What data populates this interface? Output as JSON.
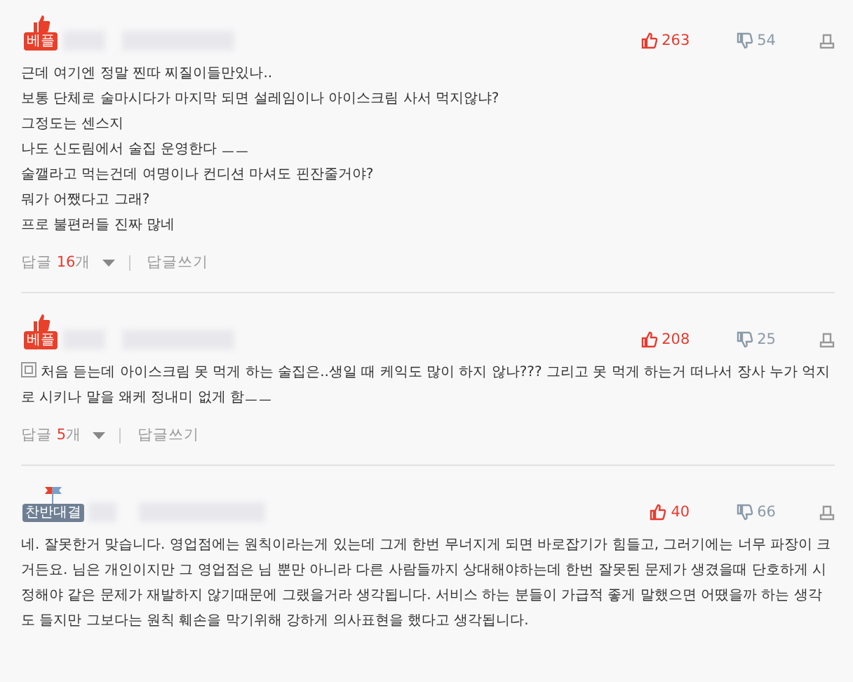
{
  "comments": [
    {
      "badge": {
        "kind": "best",
        "label": "베플"
      },
      "likes": "263",
      "dislikes": "54",
      "memo_icon": false,
      "lines": [
        "근데 여기엔 정말 찐따 찌질이들만있나..",
        "보통 단체로 술마시다가 마지막 되면 설레임이나 아이스크림 사서 먹지않냐?",
        "그정도는 센스지",
        "나도 신도림에서 술집 운영한다 ㅡㅡ",
        "술깰라고 먹는건데 여명이나 컨디션 마셔도 핀잔줄거야?",
        "뭐가 어쨌다고 그래?",
        "프로 불편러들 진짜 많네"
      ],
      "replies": {
        "label": "답글",
        "count": "16",
        "unit": "개",
        "write": "답글쓰기"
      }
    },
    {
      "badge": {
        "kind": "best",
        "label": "베플"
      },
      "likes": "208",
      "dislikes": "25",
      "memo_icon": true,
      "lines": [
        "처음 듣는데 아이스크림 못 먹게 하는 술집은..생일 때 케익도 많이 하지 않나??? 그리고 못 먹게 하는거 떠나서 장사 누가 억지로 시키나 말을 왜케 정내미 없게 함ㅡㅡ"
      ],
      "replies": {
        "label": "답글",
        "count": "5",
        "unit": "개",
        "write": "답글쓰기"
      }
    },
    {
      "badge": {
        "kind": "debate",
        "label": "찬반대결"
      },
      "likes": "40",
      "dislikes": "66",
      "memo_icon": false,
      "lines": [
        "네. 잘못한거 맞습니다. 영업점에는 원칙이라는게 있는데 그게 한번 무너지게 되면 바로잡기가 힘들고, 그러기에는 너무 파장이 크거든요. 님은 개인이지만 그 영업점은 님 뿐만 아니라 다른 사람들까지 상대해야하는데 한번 잘못된 문제가 생겼을때 단호하게 시정해야 같은 문제가 재발하지 않기때문에 그랬을거라 생각됩니다. 서비스 하는 분들이 가급적 좋게 말했으면 어땠을까 하는 생각도 들지만 그보다는 원칙 훼손을 막기위해 강하게 의사표현을 했다고 생각됩니다."
      ]
    }
  ]
}
